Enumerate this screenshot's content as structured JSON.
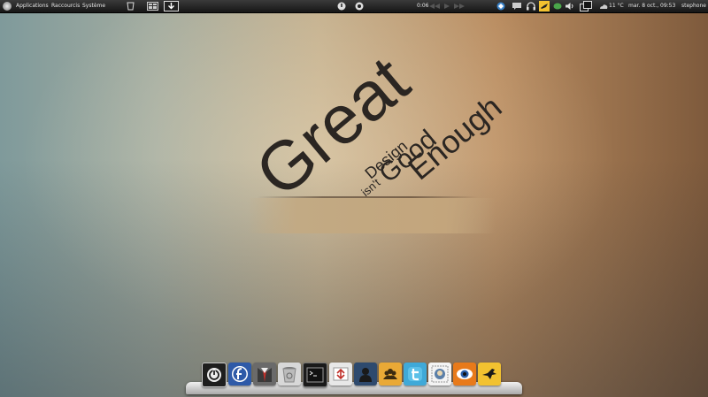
{
  "panel": {
    "menus": [
      "Applications",
      "Raccourcis",
      "Système"
    ],
    "media_time": "0:06",
    "temperature": "11 °C",
    "datetime": "mar. 8 oct., 09:53",
    "user": "stephone"
  },
  "wallpaper": {
    "word1": "Great",
    "word2": "Design",
    "word3": "isn't",
    "word4": "Good",
    "word5": "Enough"
  },
  "dock": {
    "launchers": [
      "power-icon",
      "fedora-icon",
      "suit-icon",
      "trash-icon",
      "terminal-icon",
      "firewall-icon",
      "user-account-icon",
      "contacts-icon",
      "twitter-icon",
      "mail-stamp-icon",
      "eye-icon",
      "bird-icon"
    ]
  },
  "colors": {
    "panel_bg": "#161616",
    "accent_yellow": "#f2c230",
    "twitter_blue": "#3fa9d8",
    "firefox_orange": "#e87a1a"
  }
}
